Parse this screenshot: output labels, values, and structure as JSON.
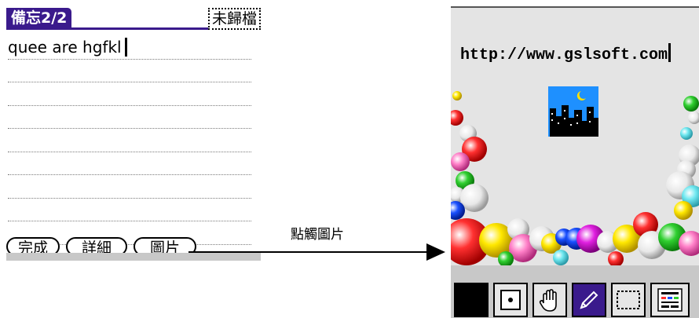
{
  "memo": {
    "title": "備忘2/2",
    "category": "未歸檔",
    "lines": [
      "quee are hgfkl",
      "",
      "",
      "",
      "",
      "",
      "",
      "",
      ""
    ],
    "buttons": {
      "done": "完成",
      "details": "詳細",
      "picture": "圖片"
    }
  },
  "arrow": {
    "label": "點觸圖片"
  },
  "picture_screen": {
    "text": "http://www.gslsoft.com"
  },
  "toolbar": {
    "tools": [
      {
        "name": "black-color-icon"
      },
      {
        "name": "dot-brush-icon"
      },
      {
        "name": "hand-icon"
      },
      {
        "name": "pencil-icon"
      },
      {
        "name": "selection-icon"
      },
      {
        "name": "settings-icon"
      }
    ]
  },
  "colors": {
    "title_bar": "#3a1a8c",
    "selected_tool": "#3a1a8c",
    "canvas": "#e4e4e4",
    "panel_gray": "#c8c8c8"
  }
}
